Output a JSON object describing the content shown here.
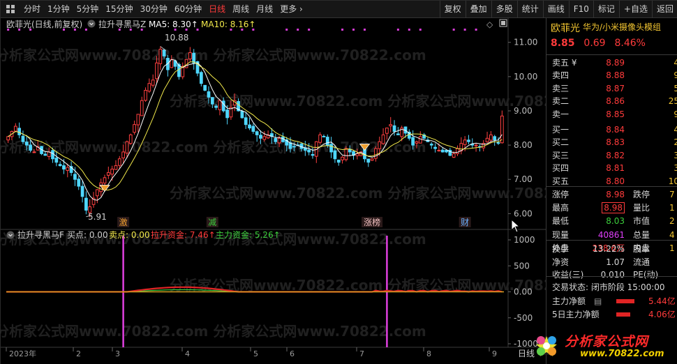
{
  "toolbar": {
    "periods": [
      "分时",
      "1分钟",
      "5分钟",
      "15分钟",
      "30分钟",
      "60分钟",
      "日线",
      "周线",
      "月线",
      "更多 ›"
    ],
    "active_period": "日线",
    "tools": [
      "复权",
      "叠加",
      "多股",
      "统计",
      "画线",
      "F10",
      "标记",
      "+自选",
      "返回"
    ]
  },
  "main_chart": {
    "legend_title": "欧菲光(日线,前复权)",
    "indicator": "拉升寻黑马Z",
    "ma5": "MA5: 8.30↑",
    "ma10": "MA10: 8.16↑",
    "high_label": "10.88",
    "low_label": "5.91",
    "price_axis": [
      "11.00",
      "10.00",
      "9.00",
      "8.00",
      "7.00",
      "6.00"
    ],
    "price_range": [
      5.6,
      11.3
    ],
    "events": [
      {
        "label": "激",
        "date_index": 31
      },
      {
        "label": "减",
        "date_index": 55
      },
      {
        "label": "涨榜",
        "date_index": 98
      },
      {
        "label": "财",
        "date_index": 123
      }
    ],
    "watermark": "分析家公式网www.70822.com"
  },
  "chart_data": {
    "type": "candlestick",
    "series": [
      {
        "name": "MA5",
        "color": "#ffffff"
      },
      {
        "name": "MA10",
        "color": "#f2e94b"
      }
    ],
    "dates_start": "2023年",
    "month_ticks": [
      "2023年",
      "2",
      "3",
      "4",
      "5",
      "6",
      "7",
      "8",
      "9"
    ],
    "closes": [
      8.25,
      8.4,
      8.55,
      8.3,
      8.1,
      8.0,
      7.85,
      7.8,
      7.95,
      7.75,
      7.7,
      7.8,
      7.6,
      7.5,
      7.4,
      7.3,
      7.35,
      7.2,
      7.0,
      6.8,
      6.5,
      6.1,
      6.2,
      6.45,
      6.7,
      6.9,
      7.05,
      7.2,
      7.3,
      7.4,
      7.6,
      7.8,
      8.1,
      8.3,
      8.6,
      8.9,
      9.3,
      9.6,
      9.8,
      9.9,
      10.4,
      10.8,
      10.6,
      10.2,
      10.5,
      10.3,
      10.0,
      10.3,
      10.5,
      10.7,
      10.4,
      10.1,
      9.8,
      9.6,
      9.4,
      9.2,
      9.1,
      9.3,
      9.0,
      8.8,
      9.1,
      9.3,
      9.0,
      8.8,
      8.6,
      8.5,
      8.4,
      8.3,
      8.2,
      8.25,
      8.3,
      8.25,
      8.1,
      8.2,
      8.1,
      8.0,
      7.9,
      7.95,
      8.0,
      7.9,
      7.85,
      7.8,
      7.7,
      8.1,
      8.3,
      8.25,
      8.0,
      7.8,
      7.6,
      7.5,
      7.65,
      7.9,
      7.8,
      7.7,
      7.75,
      7.8,
      7.6,
      7.5,
      7.6,
      7.9,
      8.1,
      8.3,
      8.5,
      8.6,
      8.4,
      8.3,
      8.5,
      8.35,
      8.2,
      8.0,
      8.1,
      8.25,
      8.2,
      8.1,
      8.0,
      7.9,
      7.85,
      7.8,
      7.8,
      7.7,
      7.75,
      7.9,
      8.05,
      8.15,
      8.1,
      8.0,
      8.0,
      7.95,
      8.05,
      8.2,
      8.3,
      8.15,
      8.05,
      8.85
    ],
    "volume_ref": {
      "ylim": [
        -1000,
        1000
      ],
      "buy_spike_indexes": [
        31,
        102
      ],
      "ticks": [
        "1000",
        "500",
        "0.00",
        "-500",
        "-1000"
      ]
    }
  },
  "sub_chart": {
    "title": "拉升寻黑马F",
    "buy": "买点: 0.00",
    "sell": "卖点: 0.00",
    "lift_fund": "拉升资金: 7.46↑",
    "main_fund": "主力资金: 5.26↑"
  },
  "bottom_axis_label": "日线",
  "panel": {
    "name": "欧菲光",
    "subtitle": "华为/小米摄像头模组",
    "price": "8.85",
    "change": "0.69",
    "change_pct": "8.46%",
    "asks": [
      {
        "label": "卖五 ¥",
        "price": "8.89",
        "vol": "4"
      },
      {
        "label": "卖四",
        "price": "8.88",
        "vol": "9"
      },
      {
        "label": "卖三",
        "price": "8.87",
        "vol": "5"
      },
      {
        "label": "卖二",
        "price": "8.86",
        "vol": "25"
      },
      {
        "label": "卖一",
        "price": "8.85",
        "vol": "9"
      }
    ],
    "bids": [
      {
        "label": "买一",
        "price": "8.84",
        "vol": "4"
      },
      {
        "label": "买二",
        "price": "8.83",
        "vol": "2"
      },
      {
        "label": "买三",
        "price": "8.82",
        "vol": "3"
      },
      {
        "label": "买四",
        "price": "8.81",
        "vol": "3"
      },
      {
        "label": "买五",
        "price": "8.80",
        "vol": "10"
      }
    ],
    "stats": [
      {
        "l": "涨停",
        "v": "8.98",
        "l2": "跌停",
        "v2": "7"
      },
      {
        "l": "最高",
        "v": "8.98",
        "l2": "量比",
        "v2": "1"
      },
      {
        "l": "最低",
        "v": "8.03",
        "l2": "市值",
        "v2": "2"
      },
      {
        "l": "现量",
        "v": "40861",
        "l2": "总量",
        "v2": "4"
      },
      {
        "l": "外盘",
        "v": "238.6万",
        "l2": "内盘",
        "v2": "1"
      }
    ],
    "stats2": [
      {
        "l": "换手",
        "v": "13.22%",
        "l2": "股本"
      },
      {
        "l": "净资",
        "v": "1.07",
        "l2": "流通"
      },
      {
        "l": "收益(三)",
        "v": "0.010",
        "l2": "PE(动)"
      }
    ],
    "trade_status": "交易状态: 闭市阶段 15:00:00",
    "net_main": {
      "label": "主力净额",
      "value": "5.44亿"
    },
    "net_main5": {
      "label": "5日主力净额",
      "value": "4.06亿"
    }
  },
  "logo": {
    "text": "分析家公式网",
    "url_text": "www.70822.com"
  }
}
